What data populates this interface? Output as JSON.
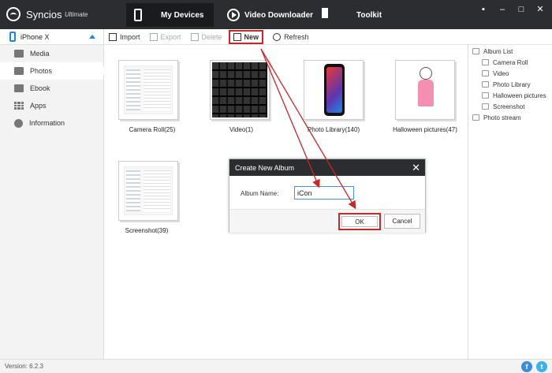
{
  "app": {
    "name": "Syncios",
    "edition": "Ultimate"
  },
  "nav": {
    "tabs": [
      {
        "label": "My Devices",
        "active": true,
        "icon": "phone-icon"
      },
      {
        "label": "Video Downloader",
        "active": false,
        "icon": "play-icon"
      },
      {
        "label": "Toolkit",
        "active": false,
        "icon": "grid-icon"
      }
    ]
  },
  "window_controls": {
    "menu": "▪",
    "minimize": "–",
    "maximize": "□",
    "close": "✕"
  },
  "sidebar": {
    "device": "iPhone X",
    "items": [
      {
        "label": "Media",
        "icon": "media-icon"
      },
      {
        "label": "Photos",
        "icon": "photos-icon",
        "active": true
      },
      {
        "label": "Ebook",
        "icon": "ebook-icon"
      },
      {
        "label": "Apps",
        "icon": "apps-icon"
      },
      {
        "label": "Information",
        "icon": "info-icon"
      }
    ]
  },
  "toolbar": {
    "import": "Import",
    "export": "Export",
    "delete": "Delete",
    "new": "New",
    "refresh": "Refresh"
  },
  "albums": [
    {
      "label": "Camera Roll(25)"
    },
    {
      "label": "Video(1)"
    },
    {
      "label": "Photo Library(140)"
    },
    {
      "label": "Halloween pictures(47)"
    },
    {
      "label": "Screenshot(39)"
    }
  ],
  "right_panel": {
    "root": "Album List",
    "children": [
      "Camera Roll",
      "Video",
      "Photo Library",
      "Halloween pictures",
      "Screenshot"
    ],
    "photo_stream": "Photo stream"
  },
  "dialog": {
    "title": "Create New Album",
    "close": "✕",
    "field_label": "Album Name:",
    "field_value": "iCon",
    "ok": "OK",
    "cancel": "Cancel"
  },
  "status": {
    "version": "Version: 6.2.3",
    "facebook": "f",
    "twitter": "t"
  },
  "colors": {
    "titlebar": "#2b2d30",
    "accent": "#1e88e5",
    "annotation": "#c62828"
  }
}
